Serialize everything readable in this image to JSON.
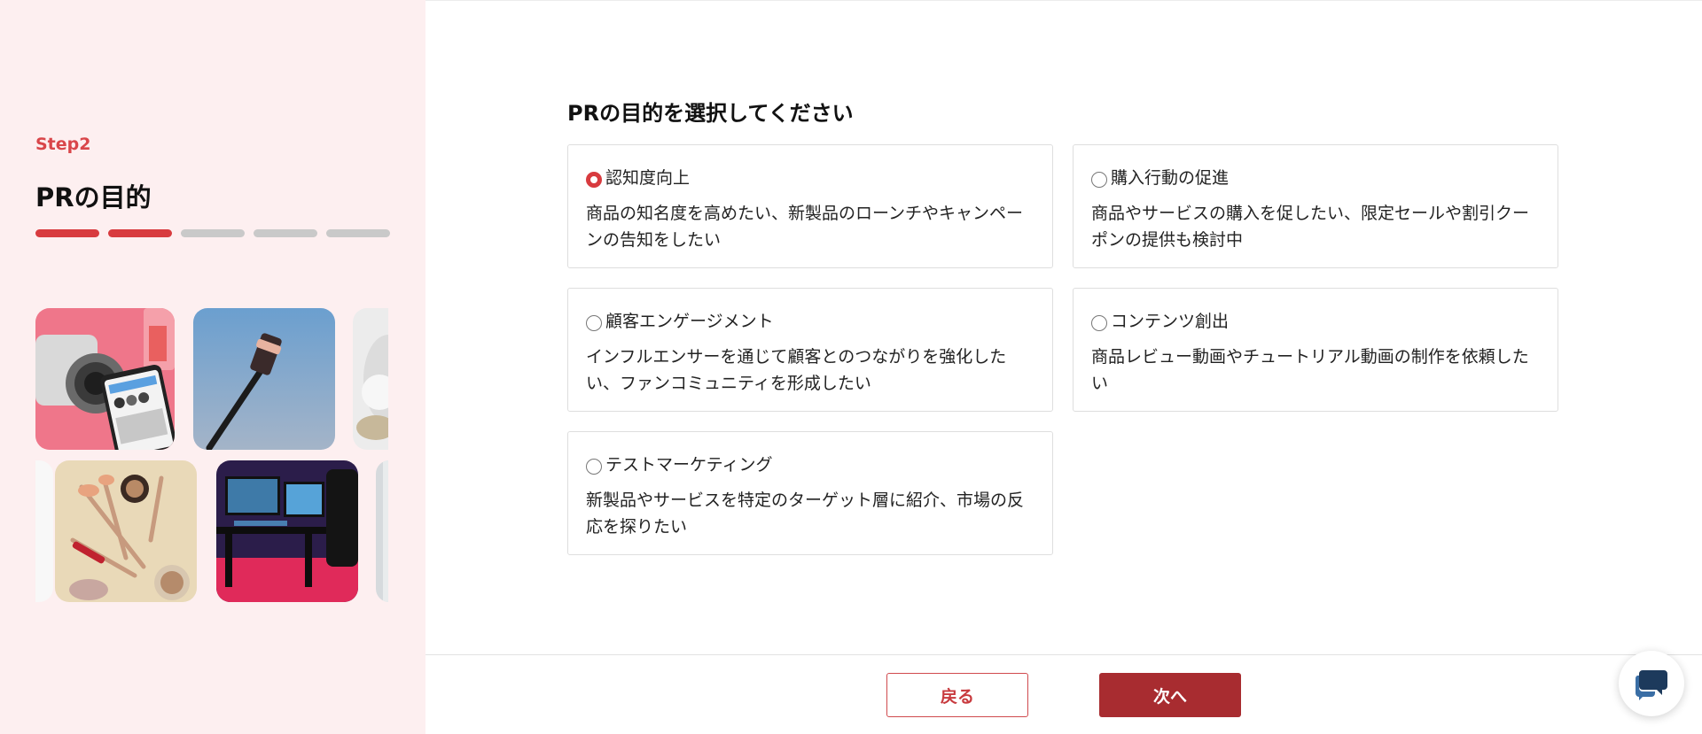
{
  "sidebar": {
    "step_label": "Step2",
    "step_title": "PRの目的",
    "progress": {
      "total_steps": 5,
      "completed_steps": 2
    },
    "gallery": [
      "camera-and-phone-photo",
      "selfie-stick-photo",
      "cup-photo",
      "cosmetics-photo",
      "gaming-setup-photo",
      "partial-photo"
    ]
  },
  "main": {
    "question": "PRの目的を選択してください",
    "options": [
      {
        "label": "認知度向上",
        "description": "商品の知名度を高めたい、新製品のローンチやキャンペーンの告知をしたい",
        "selected": true
      },
      {
        "label": "購入行動の促進",
        "description": "商品やサービスの購入を促したい、限定セールや割引クーポンの提供も検討中",
        "selected": false
      },
      {
        "label": "顧客エンゲージメント",
        "description": "インフルエンサーを通じて顧客とのつながりを強化したい、ファンコミュニティを形成したい",
        "selected": false
      },
      {
        "label": "コンテンツ創出",
        "description": "商品レビュー動画やチュートリアル動画の制作を依頼したい",
        "selected": false
      },
      {
        "label": "テストマーケティング",
        "description": "新製品やサービスを特定のターゲット層に紹介、市場の反応を探りたい",
        "selected": false
      }
    ]
  },
  "footer": {
    "back_label": "戻る",
    "next_label": "次へ"
  },
  "chat_widget": {
    "icon": "chat-bubble-icon"
  },
  "colors": {
    "accent": "#d83b3f",
    "primary_button": "#a82c30",
    "sidebar_bg": "#fdeff0"
  }
}
